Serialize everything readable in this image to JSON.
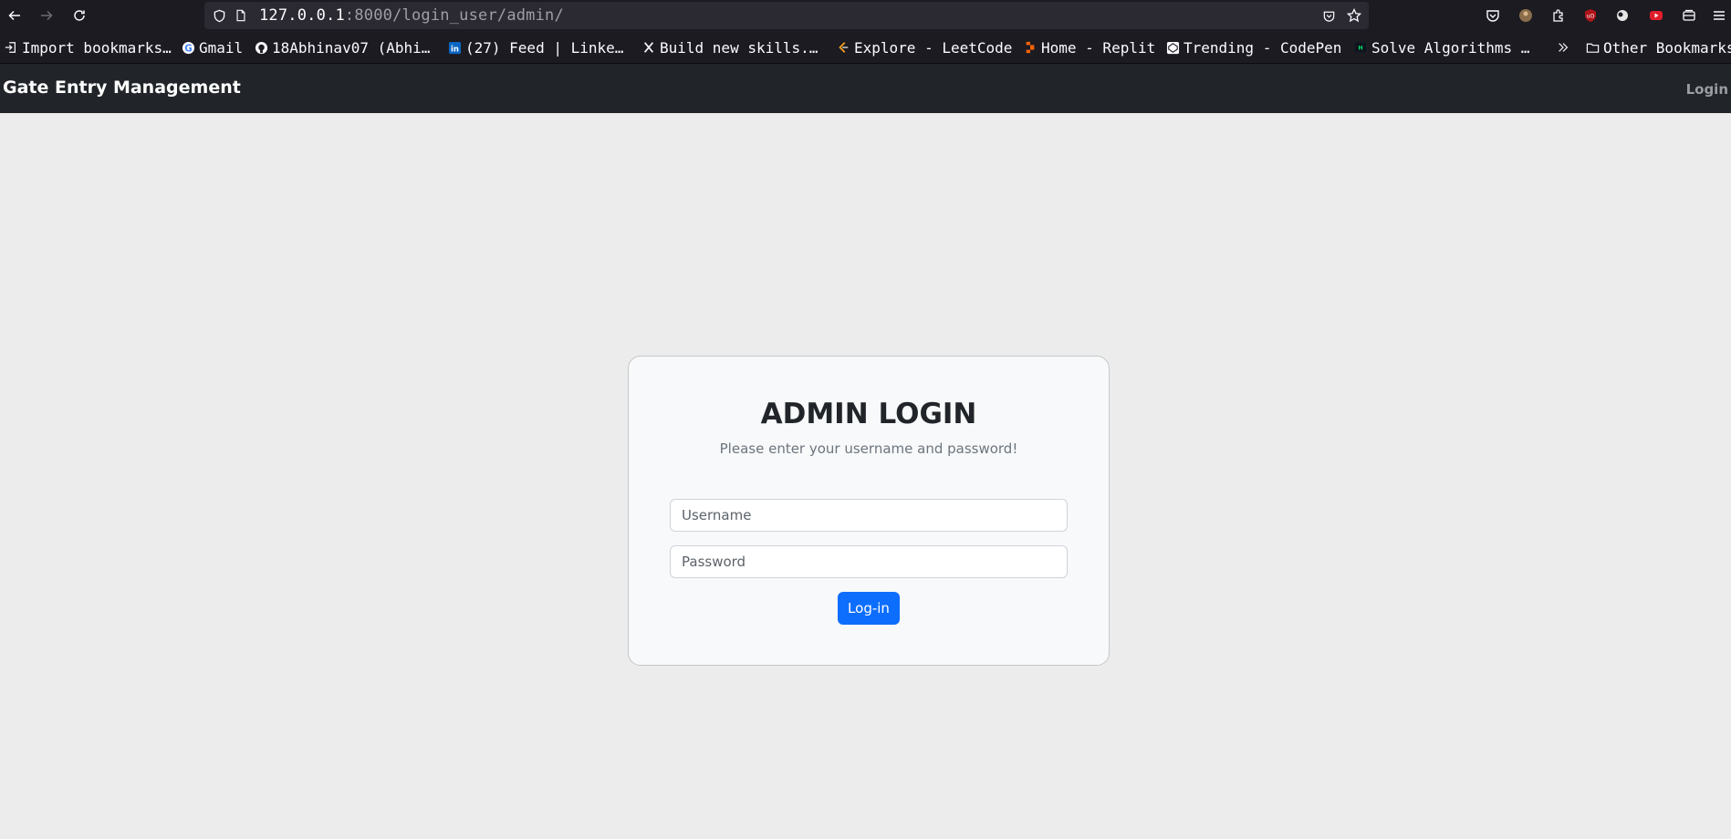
{
  "browser": {
    "url_host": "127.0.0.1",
    "url_rest": ":8000/login_user/admin/",
    "bookmarks": [
      {
        "label": "Import bookmarks…",
        "icon": "import-icon"
      },
      {
        "label": "Gmail",
        "icon": "google-icon"
      },
      {
        "label": "18Abhinav07 (Abhi…",
        "icon": "github-icon"
      },
      {
        "label": "(27) Feed | Linke…",
        "icon": "linkedin-icon"
      },
      {
        "label": "Build new skills.…",
        "icon": "x-icon"
      },
      {
        "label": "Explore - LeetCode",
        "icon": "leetcode-icon"
      },
      {
        "label": "Home - Replit",
        "icon": "replit-icon"
      },
      {
        "label": "Trending - CodePen",
        "icon": "codepen-icon"
      },
      {
        "label": "Solve Algorithms …",
        "icon": "hackerrank-icon"
      }
    ],
    "other_bookmarks": "Other Bookmarks"
  },
  "navbar": {
    "brand": "Gate Entry Management",
    "login_link": "Login"
  },
  "login_card": {
    "title": "ADMIN LOGIN",
    "subtitle": "Please enter your username and password!",
    "username_placeholder": "Username",
    "password_placeholder": "Password",
    "submit_label": "Log-in"
  },
  "colors": {
    "navbar_bg": "#212529",
    "page_bg": "#ececec",
    "card_bg": "#f8f9fa",
    "primary_button": "#0d6efd"
  }
}
